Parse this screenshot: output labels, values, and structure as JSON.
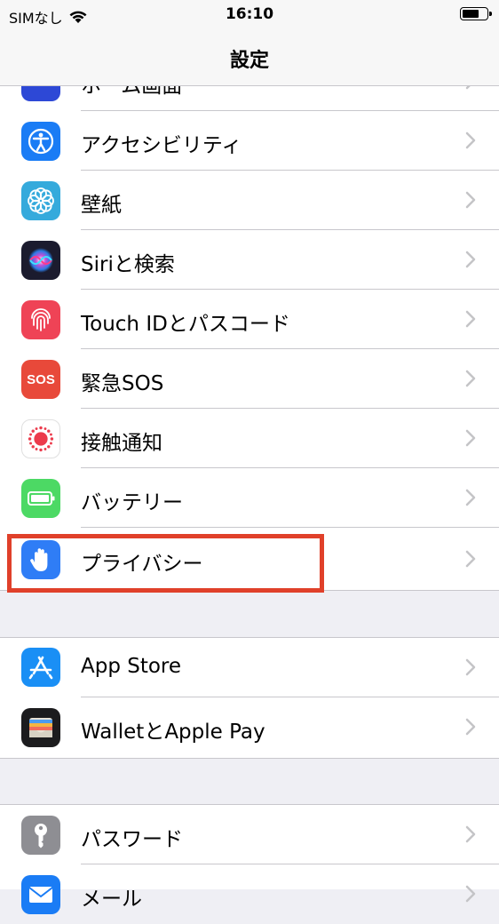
{
  "status": {
    "carrier": "SIMなし",
    "time": "16:10"
  },
  "nav": {
    "title": "設定"
  },
  "partial_row": {
    "label": "ホーム画面"
  },
  "group1": [
    {
      "label": "アクセシビリティ",
      "icon": "accessibility-icon",
      "color": "#1a7cf5"
    },
    {
      "label": "壁紙",
      "icon": "wallpaper-flower-icon",
      "color": "#35aadc"
    },
    {
      "label": "Siriと検索",
      "icon": "siri-icon",
      "color": "#1b1b2e"
    },
    {
      "label": "Touch IDとパスコード",
      "icon": "fingerprint-icon",
      "color": "#ef4356"
    },
    {
      "label": "緊急SOS",
      "icon": "sos-icon",
      "color": "#e8493a",
      "icon_text": "SOS"
    },
    {
      "label": "接触通知",
      "icon": "exposure-notification-icon",
      "color": "#ffffff"
    },
    {
      "label": "バッテリー",
      "icon": "battery-icon",
      "color": "#4cd964"
    },
    {
      "label": "プライバシー",
      "icon": "privacy-hand-icon",
      "color": "#2f7df6"
    }
  ],
  "group2": [
    {
      "label": "App Store",
      "icon": "app-store-icon",
      "color": "#1a8ff5"
    },
    {
      "label": "WalletとApple Pay",
      "icon": "wallet-icon",
      "color": "#1c1c1e"
    }
  ],
  "group3": [
    {
      "label": "パスワード",
      "icon": "key-icon",
      "color": "#8e8e93"
    },
    {
      "label": "メール",
      "icon": "mail-icon",
      "color": "#1a7cf5"
    }
  ],
  "highlight_color": "#e0402a"
}
